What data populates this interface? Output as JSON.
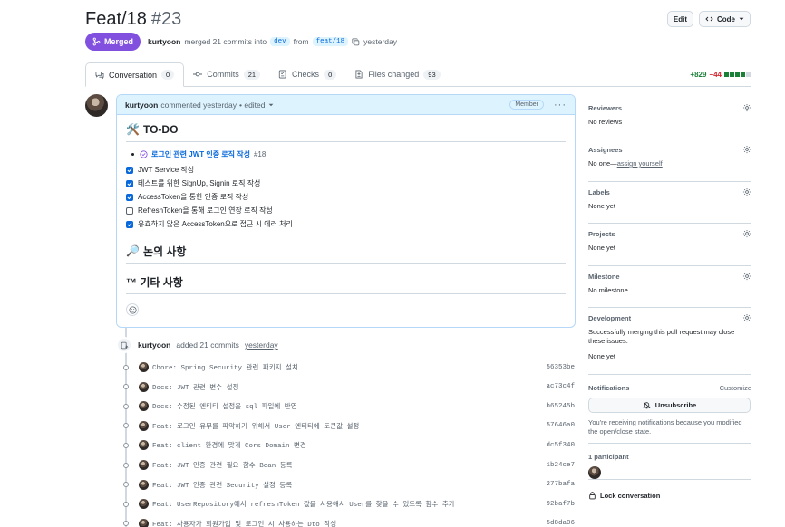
{
  "header": {
    "title": "Feat/18",
    "number": "#23",
    "edit_label": "Edit",
    "code_label": "Code"
  },
  "meta": {
    "status": "Merged",
    "author": "kurtyoon",
    "action": "merged 21 commits into",
    "base_branch": "dev",
    "from_word": "from",
    "head_branch": "feat/18",
    "time": "yesterday"
  },
  "tabs": [
    {
      "label": "Conversation",
      "count": "0"
    },
    {
      "label": "Commits",
      "count": "21"
    },
    {
      "label": "Checks",
      "count": "0"
    },
    {
      "label": "Files changed",
      "count": "93"
    }
  ],
  "diffstat": {
    "additions": "+829",
    "deletions": "−44"
  },
  "comment": {
    "author": "kurtyoon",
    "action": "commented yesterday",
    "edited": "• edited",
    "role": "Member",
    "heading1": "TO-DO",
    "heading1_icon": "🛠️",
    "issue_title": "로그인 관련 JWT 인증 로직 작성",
    "issue_ref": "#18",
    "tasks": [
      {
        "text": "JWT Service 작성",
        "checked": true
      },
      {
        "text": "테스트를 위한 SignUp, Signin 로직 작성",
        "checked": true
      },
      {
        "text": "AccessToken을 통한 인증 로직 작성",
        "checked": true
      },
      {
        "text": "RefreshToken을 통해 로그인 연장 로직 작성",
        "checked": false
      },
      {
        "text": "유효하지 않은 AccessToken으로 접근 시 에러 처리",
        "checked": true
      }
    ],
    "heading2": "논의 사항",
    "heading2_icon": "🔎",
    "heading3": "™ 기타 사항"
  },
  "timeline": {
    "author": "kurtyoon",
    "action": "added 21 commits",
    "time": "yesterday",
    "commits": [
      {
        "msg": "Chore: Spring Security 관련 패키지 설치",
        "sha": "56353be"
      },
      {
        "msg": "Docs: JWT 관련 변수 설정",
        "sha": "ac73c4f"
      },
      {
        "msg": "Docs: 수정된 엔티티 설정을 sql 파일에 반영",
        "sha": "b65245b"
      },
      {
        "msg": "Feat: 로그인 유무를 파악하기 위해서 User 엔티티에 토큰값 설정",
        "sha": "57646a0"
      },
      {
        "msg": "Feat: client 환경에 맞게 Cors Domain 변경",
        "sha": "dc5f340"
      },
      {
        "msg": "Feat: JWT 인증 관련 필요 함수 Bean 등록",
        "sha": "1b24ce7"
      },
      {
        "msg": "Feat: JWT 인증 관련 Security 설정 등록",
        "sha": "277bafa"
      },
      {
        "msg": "Feat: UserRepository에서 refreshToken 값을 사용해서 User를 찾을 수 있도록 함수 추가",
        "sha": "92baf7b"
      },
      {
        "msg": "Feat: 사용자가 회원가입 및 로그인 시 사용하는 Dto 작성",
        "sha": "5d8da06"
      }
    ]
  },
  "sidebar": {
    "reviewers": {
      "title": "Reviewers",
      "value": "No reviews"
    },
    "assignees": {
      "title": "Assignees",
      "value": "No one—",
      "link": "assign yourself"
    },
    "labels": {
      "title": "Labels",
      "value": "None yet"
    },
    "projects": {
      "title": "Projects",
      "value": "None yet"
    },
    "milestone": {
      "title": "Milestone",
      "value": "No milestone"
    },
    "development": {
      "title": "Development",
      "text": "Successfully merging this pull request may close these issues.",
      "value": "None yet"
    },
    "notifications": {
      "title": "Notifications",
      "customize": "Customize",
      "button": "Unsubscribe",
      "text": "You're receiving notifications because you modified the open/close state."
    },
    "participants": {
      "title": "1 participant"
    },
    "lock": "Lock conversation"
  },
  "colors": {
    "merged": "#8250df",
    "link": "#0969da",
    "add": "#1a7f37",
    "del": "#d1242f"
  }
}
